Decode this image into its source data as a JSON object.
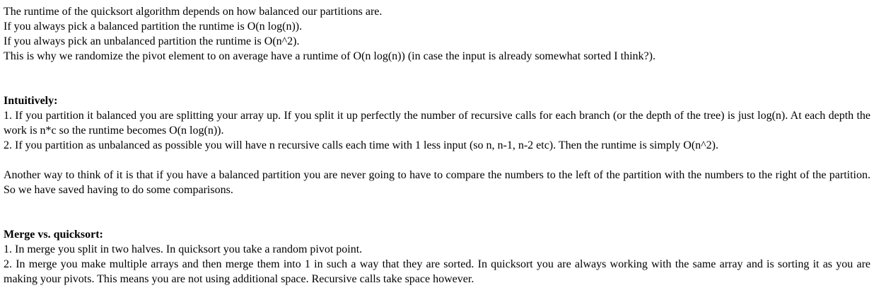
{
  "intro": {
    "line1": "The runtime of the quicksort algorithm depends on how balanced our partitions are.",
    "line2": "If you always pick a balanced partition the runtime is O(n log(n)).",
    "line3": "If you always pick an unbalanced partition the runtime is O(n^2).",
    "line4": "This is why we randomize the pivot element to on average have a runtime of O(n log(n)) (in case the input is already somewhat sorted I think?)."
  },
  "intuitively": {
    "heading": "Intuitively:",
    "point1": "1. If you partition it balanced you are splitting your array up. If you split it up perfectly the number of recursive calls for each branch (or the depth of the tree) is just log(n). At each depth the work is n*c so the runtime becomes O(n log(n)).",
    "point2": "2. If you partition as unbalanced as possible you will have n recursive calls each time with 1 less input (so n, n-1, n-2 etc). Then the runtime is simply O(n^2).",
    "paragraph": "Another way to think of it is that if you have a balanced partition you are never going to have to compare the numbers to the left of the partition with the numbers to the right of the partition. So we have saved having to do some comparisons."
  },
  "merge_vs_quicksort": {
    "heading": "Merge vs. quicksort:",
    "point1": "1. In merge you split in two halves. In quicksort you take a random pivot point.",
    "point2": "2. In merge you make multiple arrays and then merge them into 1 in such a way that they are sorted. In quicksort you are always working with the same array and is sorting it as you are making your pivots. This means you are not using additional space. Recursive calls take space however."
  }
}
